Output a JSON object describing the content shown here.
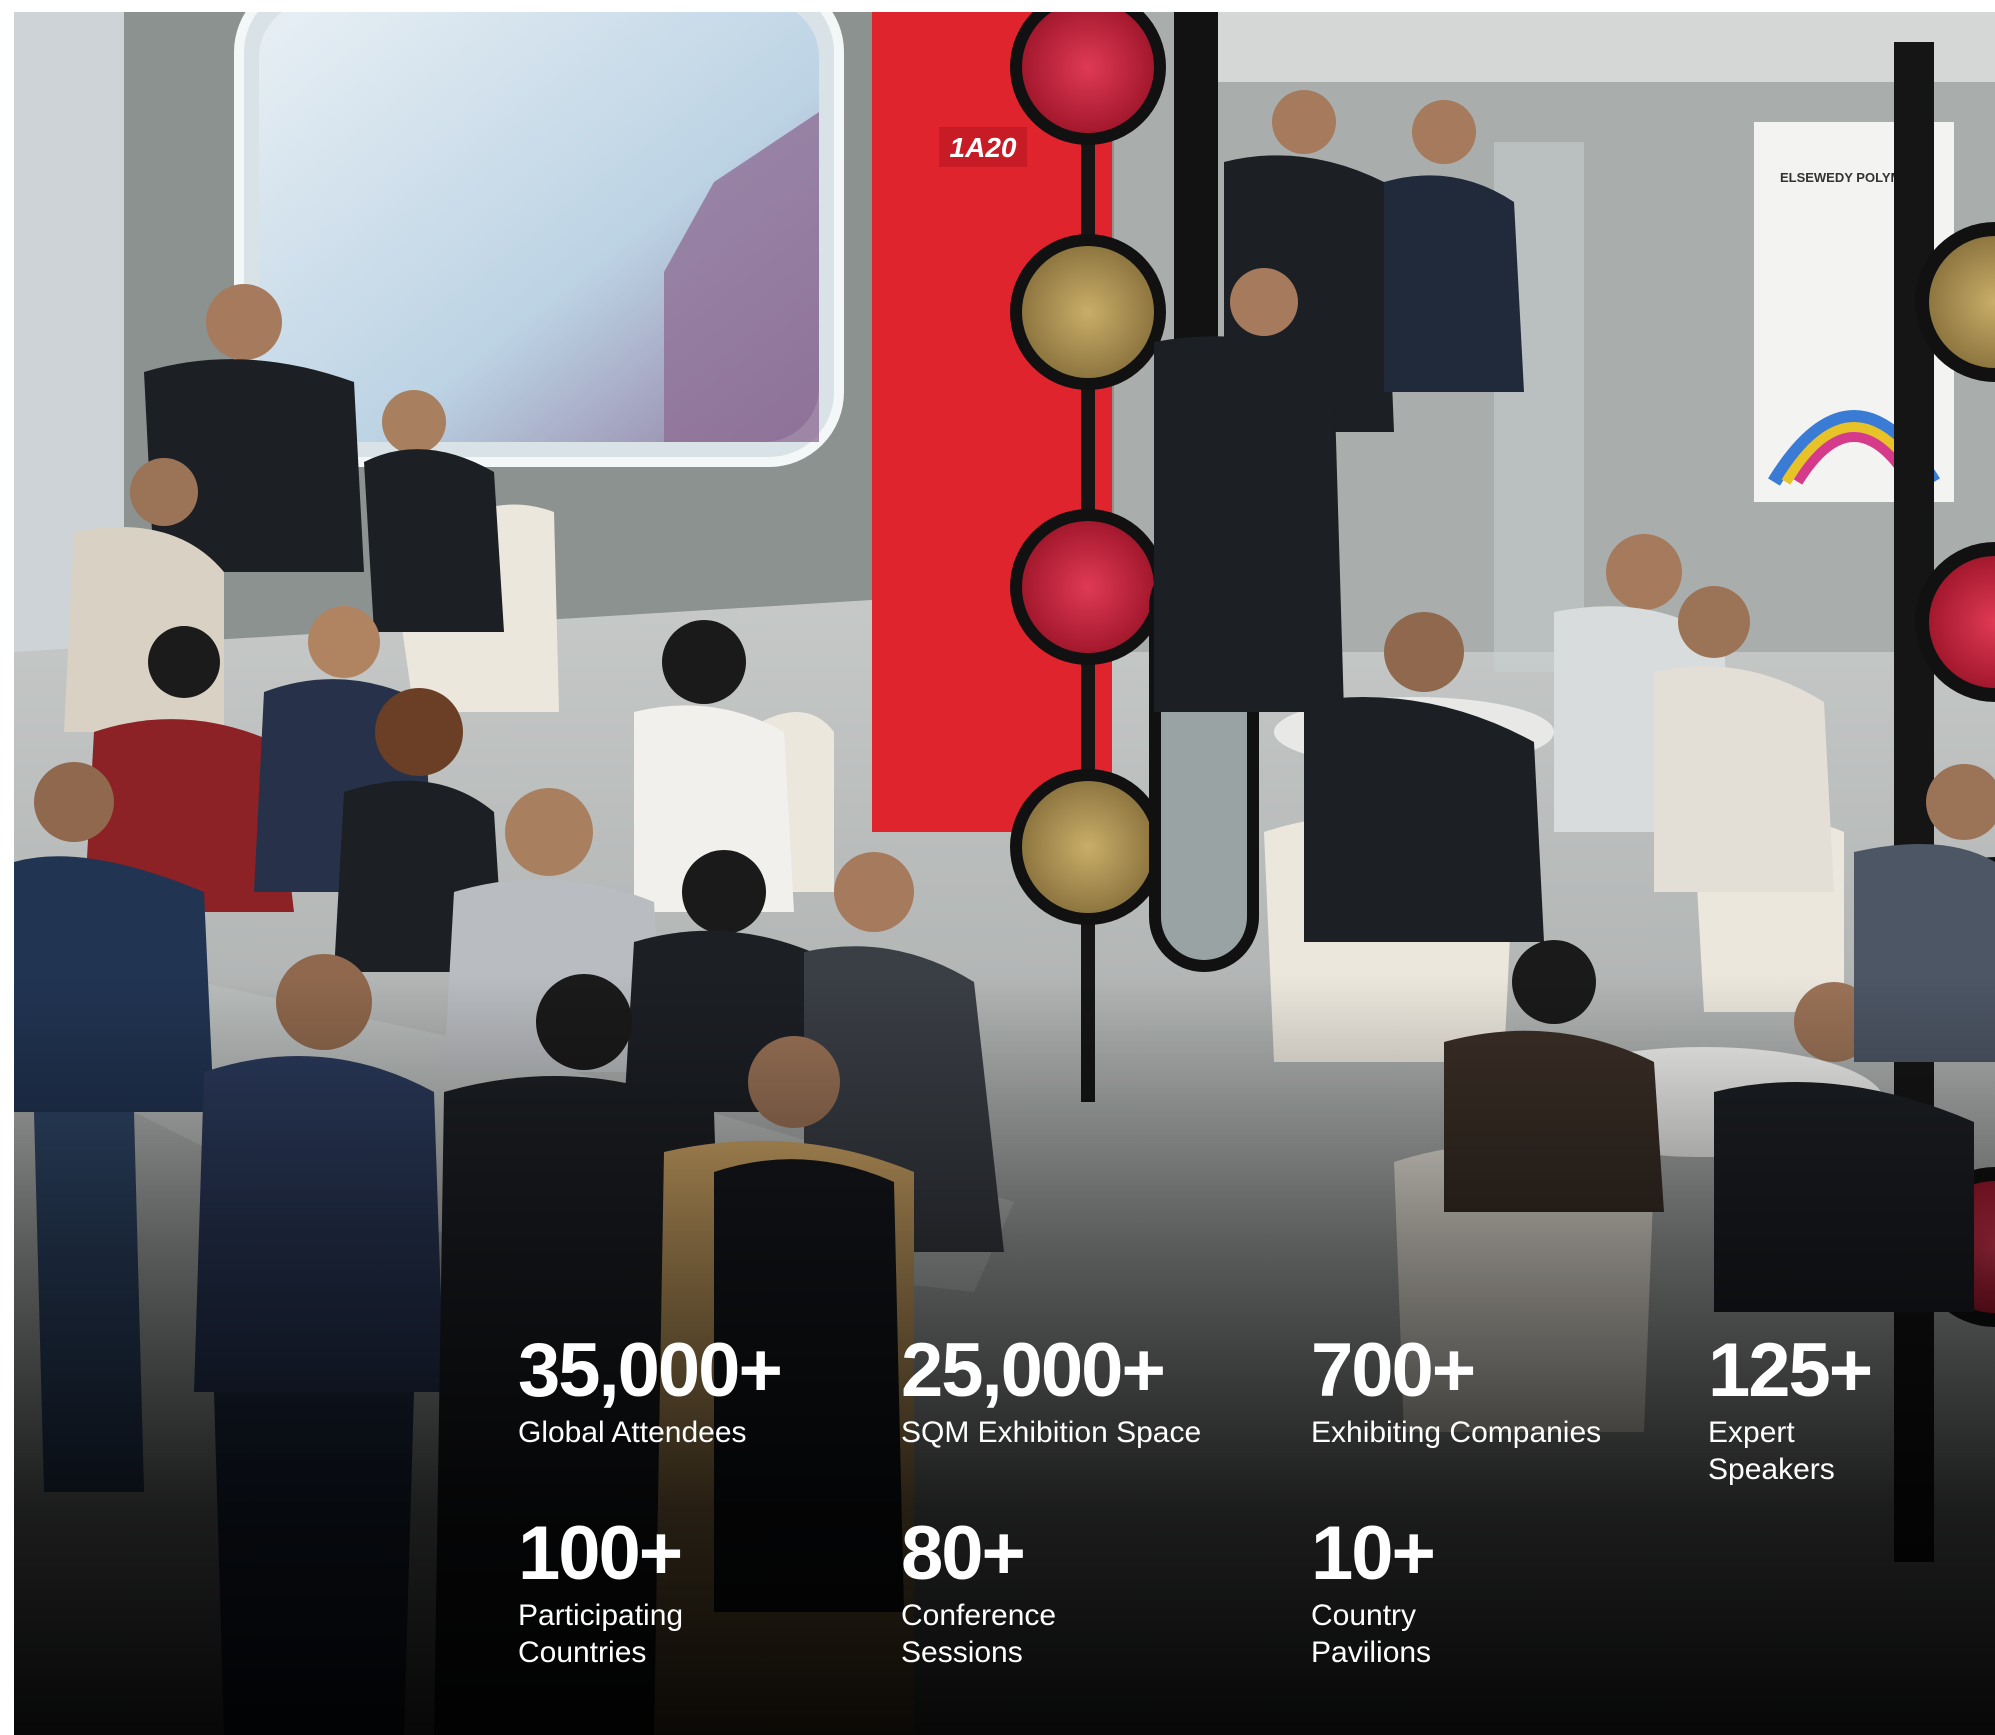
{
  "scene": {
    "booth_sign": "1A20",
    "poster_brand": "ELSEWEDY POLYMERS",
    "colors": {
      "booth_red": "#e0242e",
      "wall_grey": "#8b918f",
      "disc_red": "#c8203a",
      "disc_gold": "#b79a55"
    }
  },
  "stats": [
    {
      "value": "35,000+",
      "label": "Global Attendees"
    },
    {
      "value": "25,000+",
      "label": "SQM Exhibition Space"
    },
    {
      "value": "700+",
      "label": "Exhibiting Companies"
    },
    {
      "value": "125+",
      "label_lines": [
        "Expert",
        "Speakers"
      ]
    },
    {
      "value": "100+",
      "label_lines": [
        "Participating",
        "Countries"
      ]
    },
    {
      "value": "80+",
      "label_lines": [
        "Conference",
        "Sessions"
      ]
    },
    {
      "value": "10+",
      "label_lines": [
        "Country",
        "Pavilions"
      ]
    }
  ]
}
